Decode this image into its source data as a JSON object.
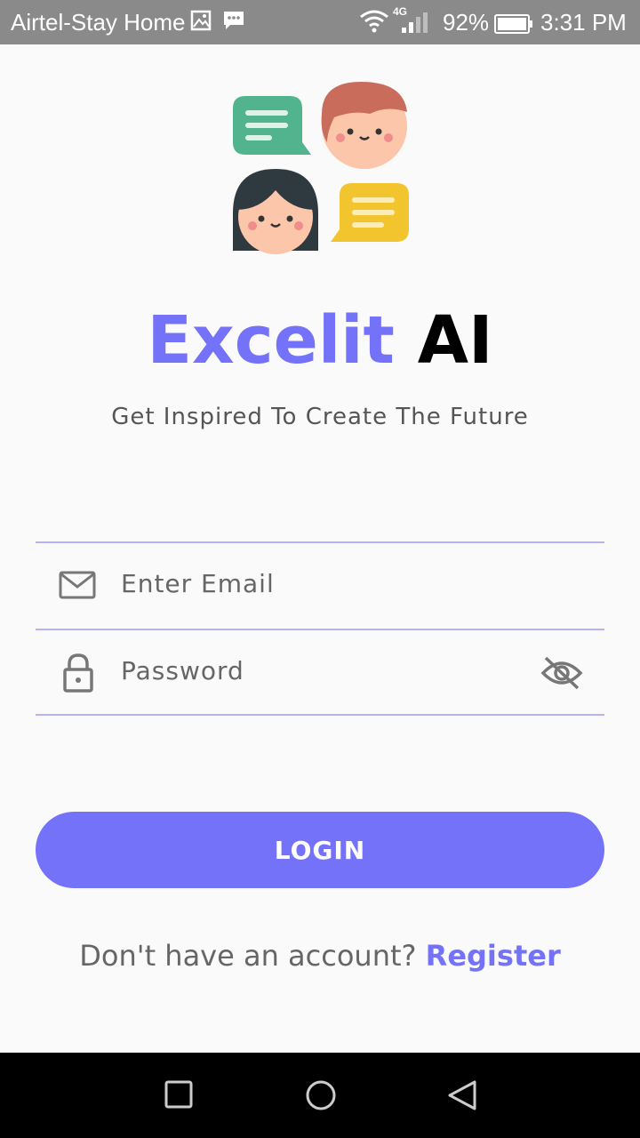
{
  "status_bar": {
    "carrier": "Airtel-Stay Home",
    "network": "4G",
    "battery": "92%",
    "time": "3:31 PM",
    "icons": [
      "gallery-icon",
      "message-icon",
      "wifi-icon",
      "signal-icon",
      "battery-icon"
    ]
  },
  "app": {
    "title_part1": "Excelit",
    "title_part2": "AI",
    "subtitle": "Get Inspired To Create The Future",
    "email": {
      "placeholder": "Enter Email",
      "value": "",
      "icon": "mail-icon"
    },
    "password": {
      "placeholder": "Password",
      "value": "",
      "icon": "lock-icon",
      "toggle_icon": "eye-off-icon"
    },
    "login_label": "LOGIN",
    "register_prompt": "Don't have an account?",
    "register_label": "Register"
  },
  "nav_bar": {
    "buttons": [
      "recents-button",
      "home-button",
      "back-button"
    ]
  },
  "colors": {
    "accent": "#7472f8",
    "status_bar": "#8a8a8a",
    "divider": "#b3b3f5",
    "logo_green": "#52b48e",
    "logo_yellow": "#f2c52e",
    "logo_hair_red": "#c96c5c",
    "logo_hair_dark": "#2e3a3f",
    "logo_skin": "#fbc6a9"
  }
}
